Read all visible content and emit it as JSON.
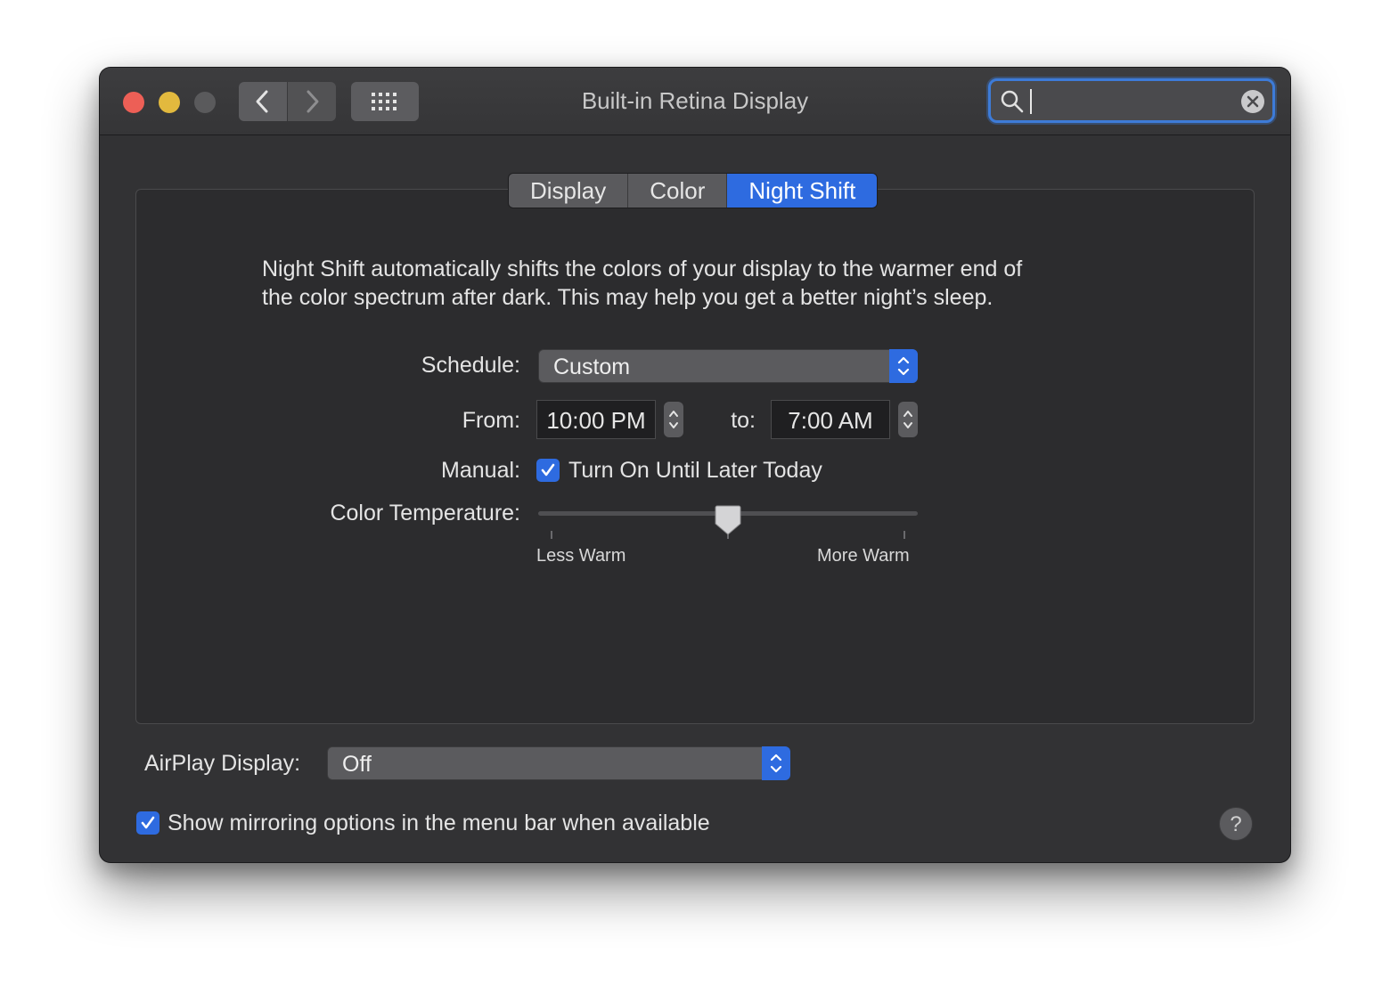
{
  "window": {
    "title": "Built-in Retina Display"
  },
  "toolbar": {
    "back_icon": "chevron-left-icon",
    "forward_icon": "chevron-right-icon",
    "grid_icon": "grid-icon"
  },
  "search": {
    "value": "",
    "placeholder": ""
  },
  "tabs": [
    {
      "label": "Display",
      "active": false
    },
    {
      "label": "Color",
      "active": false
    },
    {
      "label": "Night Shift",
      "active": true
    }
  ],
  "night_shift": {
    "description_line1": "Night Shift automatically shifts the colors of your display to the warmer end of",
    "description_line2": "the color spectrum after dark. This may help you get a better night’s sleep.",
    "schedule_label": "Schedule:",
    "schedule_value": "Custom",
    "from_label": "From:",
    "from_value": "10:00 PM",
    "to_label": "to:",
    "to_value": "7:00 AM",
    "manual_label": "Manual:",
    "manual_checkbox_label": "Turn On Until Later Today",
    "manual_checked": true,
    "color_temp_label": "Color Temperature:",
    "color_temp_level": 0.5,
    "less_warm_label": "Less Warm",
    "more_warm_label": "More Warm"
  },
  "airplay": {
    "label": "AirPlay Display:",
    "value": "Off"
  },
  "mirroring": {
    "label": "Show mirroring options in the menu bar when available",
    "checked": true
  },
  "help": {
    "label": "?"
  },
  "colors": {
    "accent": "#2e6be0",
    "window_bg": "#323234",
    "close": "#ed5f56",
    "minimize": "#e2b93e",
    "zoom_disabled": "#5a5a5c"
  }
}
